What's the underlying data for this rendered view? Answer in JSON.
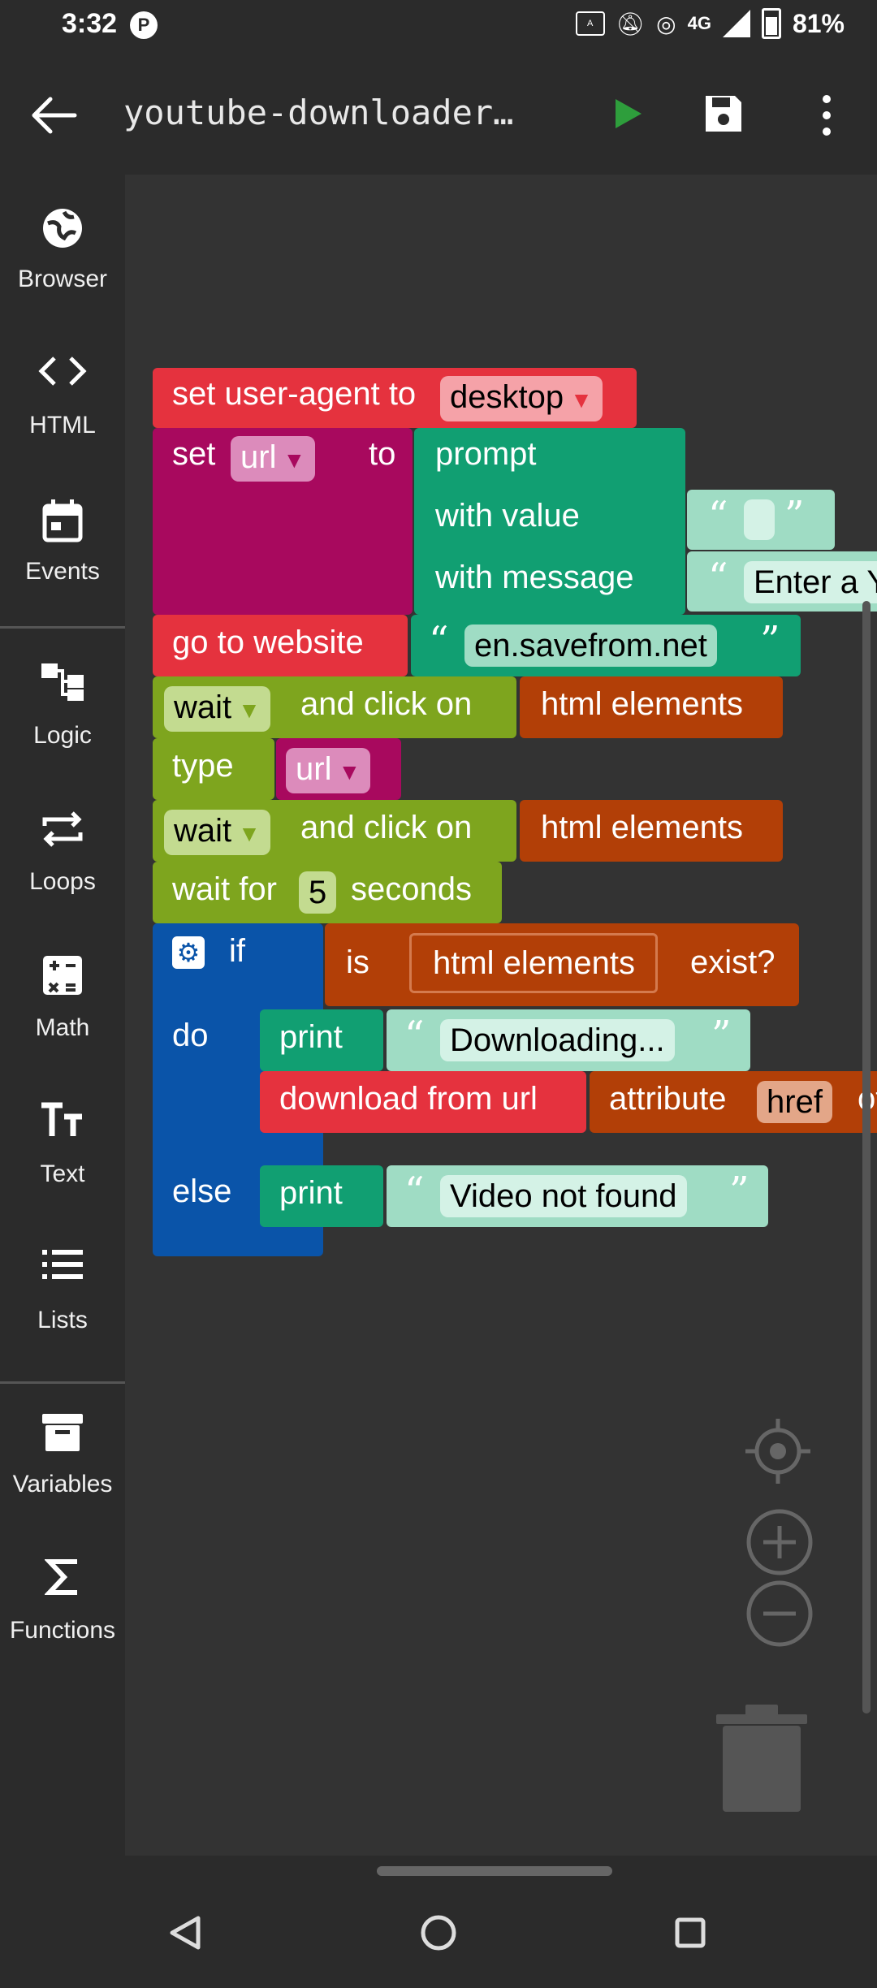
{
  "status_bar": {
    "time": "3:32",
    "p_badge": "P",
    "net": "4G",
    "battery": "81%"
  },
  "app_bar": {
    "title": "youtube-downloader…"
  },
  "sidebar": {
    "items": [
      {
        "label": "Browser",
        "icon": "globe-icon"
      },
      {
        "label": "HTML",
        "icon": "code-icon"
      },
      {
        "label": "Events",
        "icon": "calendar-icon"
      },
      {
        "label": "Logic",
        "icon": "logic-icon"
      },
      {
        "label": "Loops",
        "icon": "loop-icon"
      },
      {
        "label": "Math",
        "icon": "calculator-icon"
      },
      {
        "label": "Text",
        "icon": "text-icon"
      },
      {
        "label": "Lists",
        "icon": "list-icon"
      },
      {
        "label": "Variables",
        "icon": "archive-icon"
      },
      {
        "label": "Functions",
        "icon": "sigma-icon"
      }
    ]
  },
  "blocks": {
    "user_agent": {
      "label": "set user-agent to",
      "value": "desktop",
      "arrow": "▼"
    },
    "set_url": {
      "set": "set",
      "var": "url",
      "arrow": "▼",
      "to": "to"
    },
    "prompt": {
      "label": "prompt",
      "with_value": "with value",
      "with_message": "with message",
      "message_text": "Enter a Y"
    },
    "go_to": {
      "label": "go to website",
      "url": "en.savefrom.net"
    },
    "wait_click_1": {
      "wait": "wait",
      "arrow": "▼",
      "label": "and click on",
      "target": "html elements"
    },
    "type": {
      "label": "type",
      "var": "url",
      "arrow": "▼"
    },
    "wait_click_2": {
      "wait": "wait",
      "arrow": "▼",
      "label": "and click on",
      "target": "html elements"
    },
    "wait_for": {
      "label": "wait for",
      "seconds": "5",
      "unit": "seconds"
    },
    "if_block": {
      "if": "if",
      "do": "do",
      "else": "else",
      "is": "is",
      "elements": "html elements",
      "exist": "exist?"
    },
    "print_1": {
      "label": "print",
      "text": "Downloading..."
    },
    "download": {
      "label": "download from url",
      "attr": "attribute",
      "href": "href",
      "of": "of"
    },
    "print_2": {
      "label": "print",
      "text": "Video not found"
    },
    "quote_open": "“",
    "quote_close": "”"
  },
  "colors": {
    "red": "#e5323e",
    "magenta": "#a8095e",
    "teal": "#119f72",
    "teal_light": "#9fdcc4",
    "olive": "#7ea51e",
    "brown": "#b23f07",
    "blue": "#0a54a9"
  }
}
